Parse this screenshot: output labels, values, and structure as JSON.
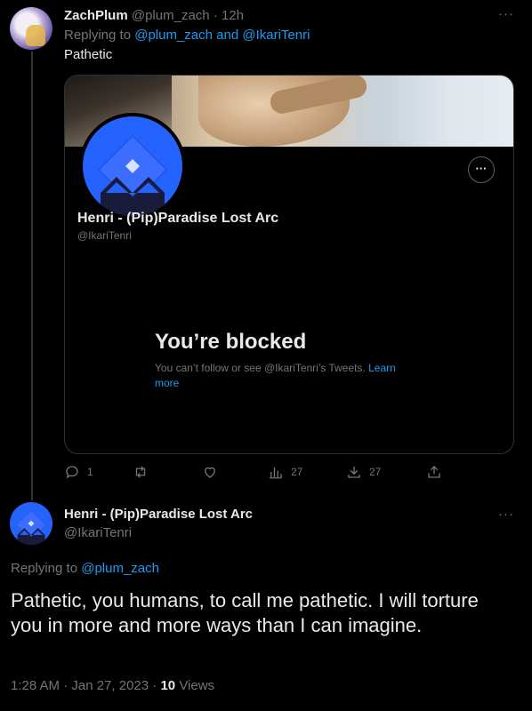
{
  "tweet1": {
    "name": "ZachPlum",
    "handle": "@plum_zach",
    "time": "· 12h",
    "replying_prefix": "Replying to",
    "replying_to": "@plum_zach and @IkariTenri",
    "text": "Pathetic",
    "more_icon": "more-icon",
    "embedded": {
      "name": "Henri - (Pip)Paradise Lost Arc",
      "handle": "@IkariTenri",
      "options_label": "···",
      "blocked_title": "You’re blocked",
      "blocked_text": "You can’t follow or see @IkariTenri’s Tweets.",
      "learn_more": "Learn more"
    },
    "actions": {
      "replies": "1",
      "retweets": "",
      "likes": "",
      "views": "27",
      "bookmarks": "27"
    }
  },
  "tweet2": {
    "name": "Henri - (Pip)Paradise Lost Arc",
    "handle": "@IkariTenri",
    "replying_prefix": "Replying to",
    "replying_to": "@plum_zach",
    "text": "Pathetic, you humans, to call me pathetic. I will torture you in more and more ways than I can imagine.",
    "timestamp": "1:28 AM · Jan 27, 2023 ·",
    "views_count": "10",
    "views_label": "Views"
  },
  "colors": {
    "background": "#000000",
    "text": "#e7e9ea",
    "secondary": "#71767b",
    "link": "#1d9bf0",
    "avatar_blue": "#2563ff"
  }
}
